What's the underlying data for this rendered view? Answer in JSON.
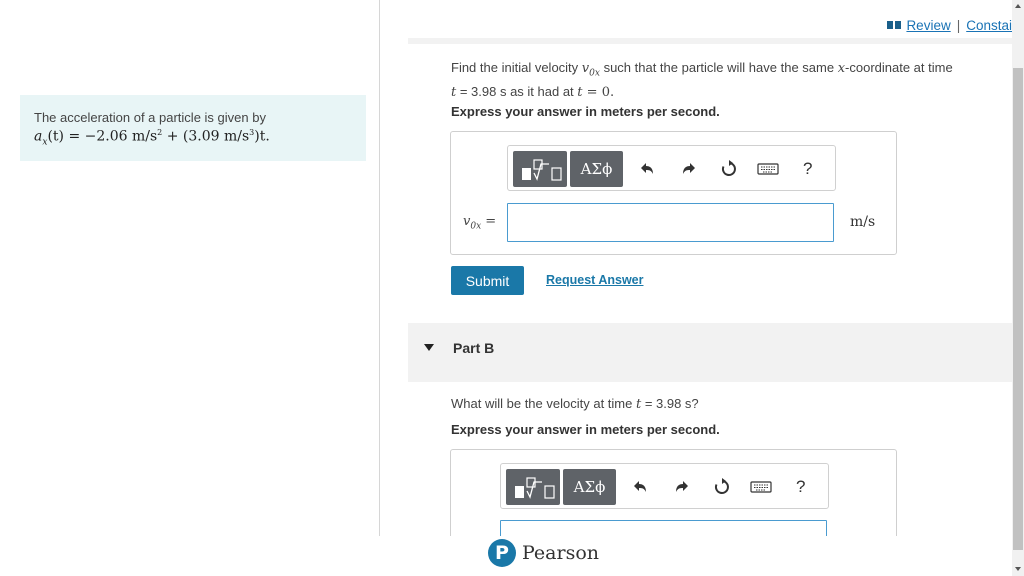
{
  "problem": {
    "statement": "The acceleration of a particle is given by",
    "formula_lhs": "a",
    "formula_sub": "x",
    "formula_t": "(t) = −2.06 m/s",
    "formula_sq": "2",
    "formula_mid": " + (3.09 m/s",
    "formula_cube": "3",
    "formula_end": ")t."
  },
  "header": {
    "review_label": "Review",
    "separator": "|",
    "constants_label": "Constai"
  },
  "part_a": {
    "question_1": "Find the initial velocity ",
    "question_var": "v",
    "question_var_sub": "0x",
    "question_2": " such that the particle will have the same ",
    "question_xcoord": "x",
    "question_3": "-coordinate at time",
    "question_line2_t": "t",
    "question_line2_a": " = 3.98 s as it had at ",
    "question_line2_t2": "t",
    "question_line2_b": " = 0.",
    "instruction": "Express your answer in meters per second.",
    "var_label": "v",
    "var_sub": "0x",
    "var_eq": " =",
    "input_value": "",
    "unit": "m/s",
    "toolbar_greek": "ΑΣϕ",
    "toolbar_help": "?",
    "submit_label": "Submit",
    "request_label": "Request Answer"
  },
  "part_b": {
    "title": "Part B",
    "question_a": "What will be the velocity at time ",
    "question_t": "t",
    "question_b": " = 3.98 s?",
    "instruction": "Express your answer in meters per second.",
    "toolbar_greek": "ΑΣϕ",
    "toolbar_help": "?"
  },
  "footer": {
    "logo_letter": "P",
    "brand": "Pearson"
  },
  "colors": {
    "accent": "#1a78a8",
    "problem_bg": "#e8f5f6",
    "section_bg": "#f2f2f2",
    "input_border": "#4a9bd0"
  }
}
